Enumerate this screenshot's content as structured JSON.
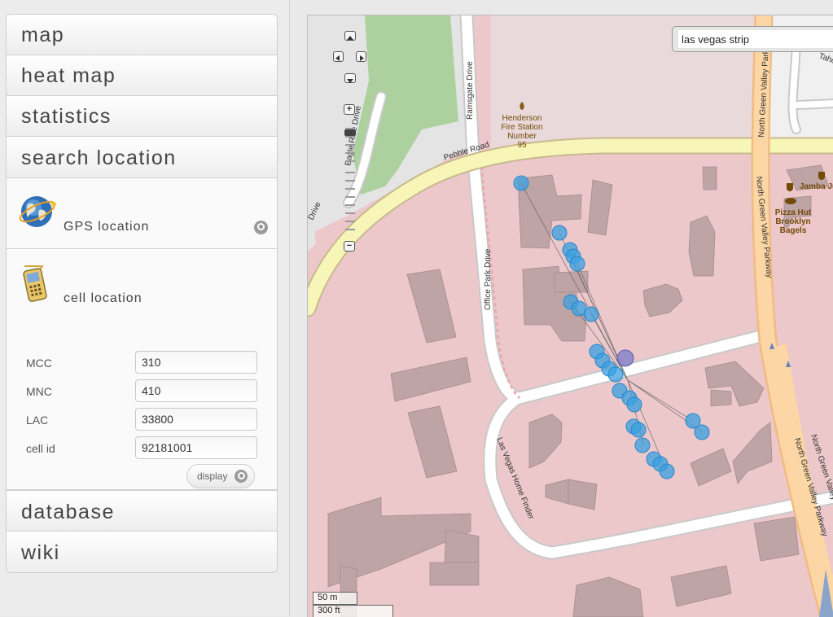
{
  "sidebar": {
    "sections": [
      {
        "label": "map"
      },
      {
        "label": "heat map"
      },
      {
        "label": "statistics"
      },
      {
        "label": "search location"
      }
    ],
    "gps": {
      "label": "GPS location"
    },
    "cell": {
      "label": "cell location",
      "fields": [
        {
          "label": "MCC",
          "value": "310"
        },
        {
          "label": "MNC",
          "value": "410"
        },
        {
          "label": "LAC",
          "value": "33800"
        },
        {
          "label": "cell id",
          "value": "92181001"
        }
      ],
      "display_label": "display"
    },
    "bottom": [
      {
        "label": "database"
      },
      {
        "label": "wiki"
      }
    ]
  },
  "map": {
    "search_value": "las vegas strip",
    "scale_m": "50 m",
    "scale_ft": "300 ft",
    "zoom_in": "+",
    "zoom_out": "−",
    "roads": {
      "pebble": "Pebble Road",
      "ramsgate": "Ramsgate Drive",
      "office_park": "Office Park Drive",
      "eagle": "Eagle Rise Drive",
      "drive_partial": "Drive",
      "ngv1": "North Green Valley Parkway",
      "ngv2": "North Green Valley Parkway",
      "ngv3": "North Green Valley Parkway",
      "ngv4": "North Green Valley Parkway",
      "lvhf": "Las Vegas Home Finder",
      "tahoe": "Tahoe"
    },
    "pois": {
      "fire": [
        "Henderson",
        "Fire Station",
        "Number",
        "95"
      ],
      "jamba": "Jamba Juice",
      "pizza": "Pizza Hut",
      "brooklyn": [
        "Brooklyn",
        "Bagels"
      ]
    },
    "colors": {
      "marker": "#3aa0e0",
      "landuse": "#ecc8cb",
      "building": "#bfa4a6",
      "major_road": "#f7f6b8",
      "park": "#add19e"
    }
  }
}
